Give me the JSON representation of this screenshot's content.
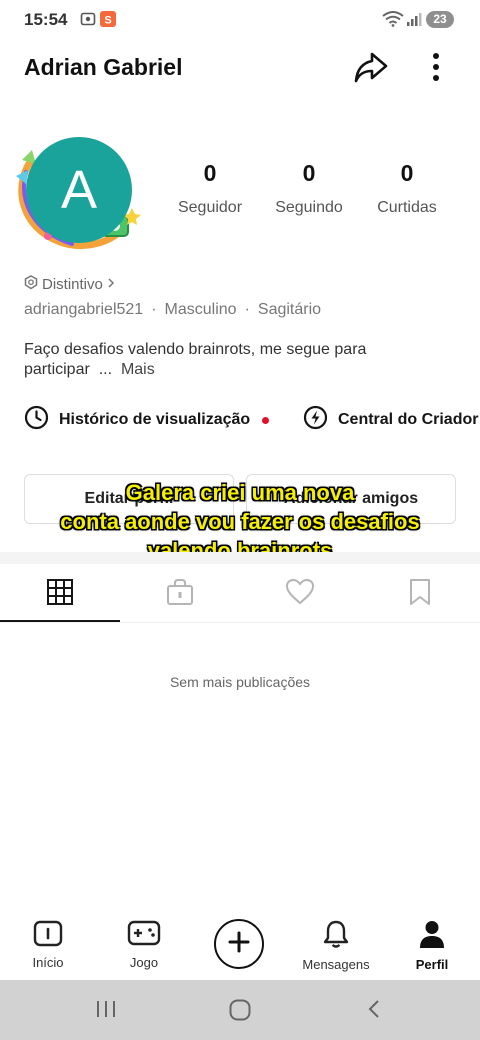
{
  "status_bar": {
    "time": "15:54",
    "battery": "23",
    "icons": [
      "screenshot-icon",
      "app-notification-icon",
      "wifi-icon",
      "signal-icon"
    ]
  },
  "header": {
    "username": "Adrian Gabriel",
    "share_icon": "share-icon",
    "menu_icon": "more-vertical-icon"
  },
  "profile": {
    "avatar_letter": "A",
    "avatar_color": "#1aa39a",
    "stats": [
      {
        "value": "0",
        "label": "Seguidor"
      },
      {
        "value": "0",
        "label": "Seguindo"
      },
      {
        "value": "0",
        "label": "Curtidas"
      }
    ],
    "badge_label": "Distintivo",
    "handle": "adriangabriel521",
    "gender": "Masculino",
    "sign": "Sagitário",
    "bio_line1": "Faço desafios valendo brainrots, me segue para",
    "bio_line2": "participar",
    "bio_ellipsis": "...",
    "bio_more": "Mais"
  },
  "shortcuts": {
    "history": "Histórico de visualização",
    "creator": "Central do Criador"
  },
  "buttons": {
    "edit_profile": "Editar perfil",
    "add_friends": "Adicionar amigos"
  },
  "caption": {
    "line1": "Galera criei uma nova",
    "line2": "conta aonde vou fazer os desafios",
    "line3": "valendo brainrots"
  },
  "tabs": [
    "grid-icon",
    "lock-bag-icon",
    "heart-icon",
    "bookmark-icon"
  ],
  "empty_message": "Sem mais publicações",
  "bottom_nav": {
    "home": "Início",
    "game": "Jogo",
    "messages": "Mensagens",
    "profile": "Perfil"
  },
  "colors": {
    "caption_text": "#f5f000",
    "accent_red": "#e0102b",
    "avatar": "#1aa39a"
  }
}
